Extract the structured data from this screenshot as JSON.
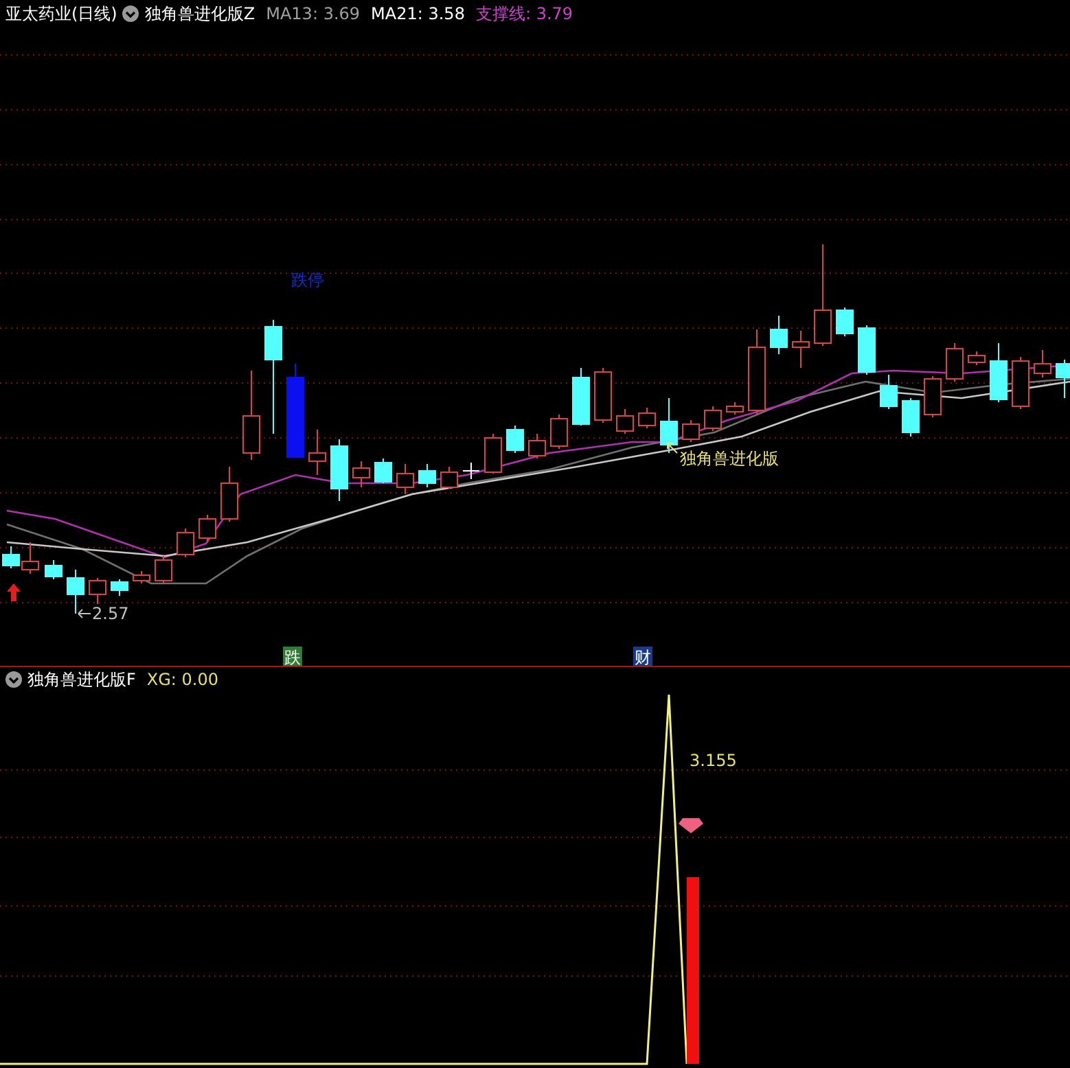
{
  "title": "亚太药业(日线)",
  "main_panel": {
    "indicator": "独角兽进化版Z",
    "readings": [
      {
        "label": "MA13:",
        "value": "3.69",
        "color": "#a0a0a0"
      },
      {
        "label": "MA21:",
        "value": "3.58",
        "color": "#ffffff"
      },
      {
        "label": "支撑线:",
        "value": "3.79",
        "color": "#cc44cc"
      }
    ],
    "annotations": [
      {
        "kind": "text",
        "text": "跌停",
        "color": "#1030d0"
      },
      {
        "kind": "pointer",
        "text": "独角兽进化版",
        "color": "#e8e070"
      },
      {
        "kind": "price",
        "text": "2.57",
        "color": "#c0c0c0"
      }
    ],
    "markers": [
      {
        "text": "跌",
        "color": "#2e7d32"
      },
      {
        "text": "财",
        "color": "#1a3a8a"
      }
    ]
  },
  "sub_panel": {
    "indicator": "独角兽进化版F",
    "readings": [
      {
        "label": "XG:",
        "value": "0.00",
        "color": "#e8e070"
      }
    ],
    "peak_label": "3.155"
  }
}
